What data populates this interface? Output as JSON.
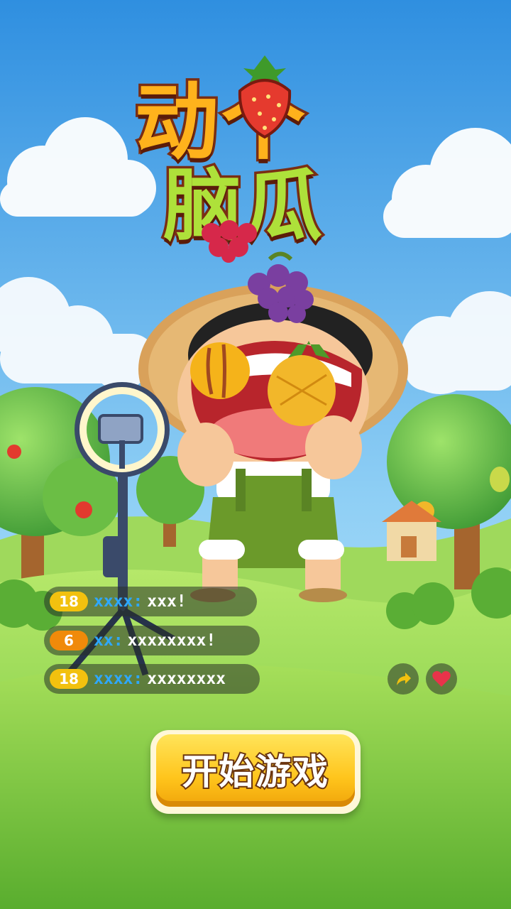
{
  "game": {
    "title_line1": "动个",
    "title_line2": "脑瓜",
    "start_button": "开始游戏"
  },
  "chat": [
    {
      "level": "18",
      "level_color": "#f2c10f",
      "name": "xxxx:",
      "message": "xxx!"
    },
    {
      "level": "6",
      "level_color": "#f08a0a",
      "name": "xx:",
      "message": "xxxxxxxx!"
    },
    {
      "level": "18",
      "level_color": "#f2c10f",
      "name": "xxxx:",
      "message": "xxxxxxxx"
    }
  ],
  "icons": {
    "share": "share-arrow-icon",
    "like": "heart-icon"
  },
  "colors": {
    "sky_top": "#2f8fe0",
    "grass": "#8fd14a",
    "button": "#ffc51c",
    "title_orange": "#ffb21c",
    "title_green": "#aee13a",
    "username": "#2ea8ff"
  }
}
